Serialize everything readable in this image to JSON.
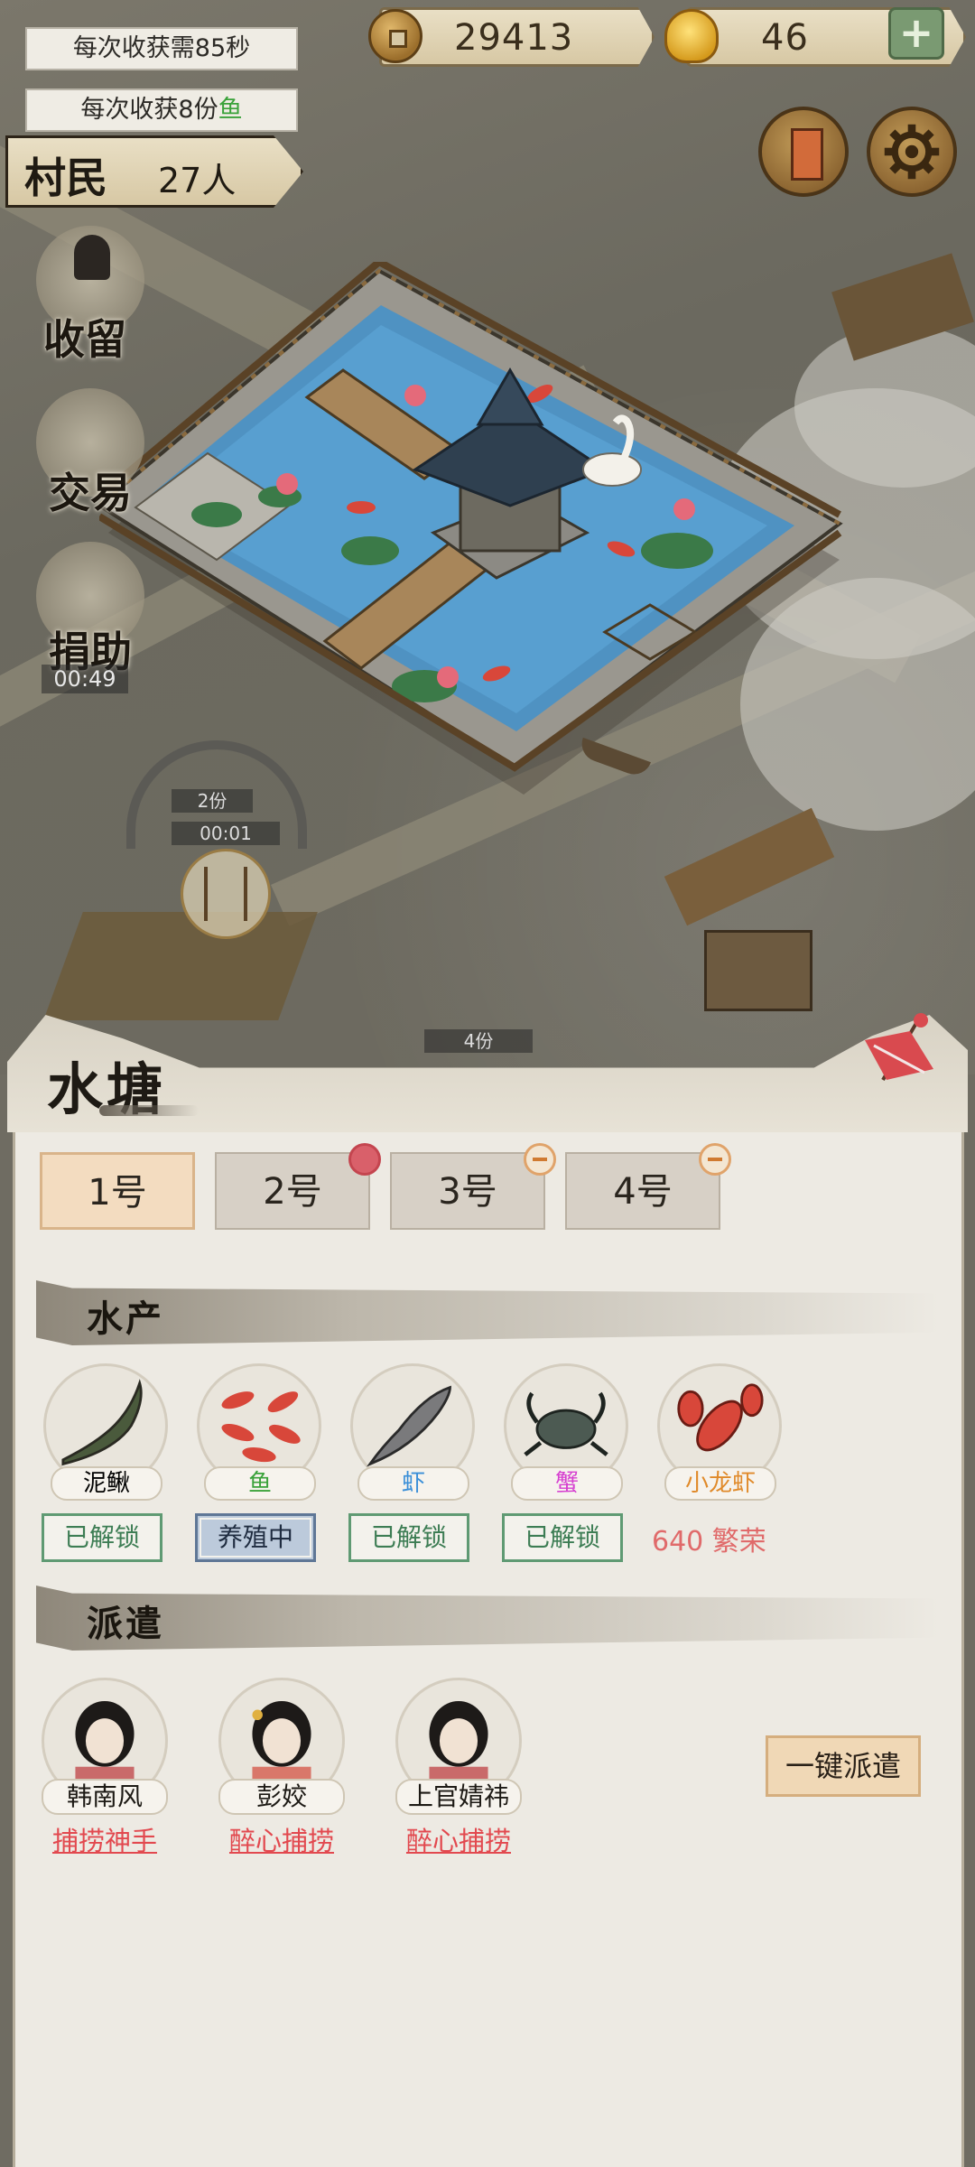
{
  "hud": {
    "harvest_time": "每次收获需85秒",
    "harvest_amount_prefix": "每次收获8份",
    "harvest_amount_item": "鱼",
    "villagers_label": "村民",
    "villagers_count": "27人",
    "coins": "29413",
    "gold": "46",
    "add_label": "+"
  },
  "side_actions": {
    "retain": "收留",
    "trade": "交易",
    "donate": "捐助",
    "donate_timer": "00:49"
  },
  "map_chips": {
    "chip1": "2份",
    "chip1_timer": "00:01",
    "chip2": "4份"
  },
  "panel": {
    "title": "水塘",
    "tabs": [
      "1号",
      "2号",
      "3号",
      "4号"
    ],
    "aquatic_section": "水产",
    "dispatch_section": "派遣",
    "items": [
      {
        "name": "泥鳅",
        "status": "已解锁",
        "color": "#2d2a25"
      },
      {
        "name": "鱼",
        "status": "养殖中",
        "color": "#3aa23a"
      },
      {
        "name": "虾",
        "status": "已解锁",
        "color": "#3a8fd8"
      },
      {
        "name": "蟹",
        "status": "已解锁",
        "color": "#d63fd0"
      },
      {
        "name": "小龙虾",
        "cost": "640 繁荣",
        "color": "#e08a2a"
      }
    ],
    "heroes": [
      {
        "name": "韩南风",
        "skill": "捕捞神手"
      },
      {
        "name": "彭姣",
        "skill": "醉心捕捞"
      },
      {
        "name": "上官婧祎",
        "skill": "醉心捕捞"
      }
    ],
    "dispatch_all": "一键派遣"
  },
  "colors": {
    "accent_red": "#e2494f",
    "status_green": "#3d7d54",
    "tab_active": "#f3dcc0"
  }
}
